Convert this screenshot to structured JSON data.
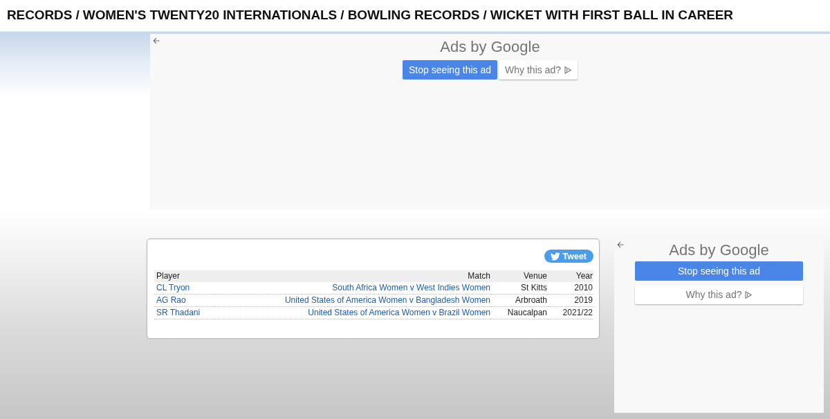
{
  "header": {
    "breadcrumb": "RECORDS / WOMEN'S TWENTY20 INTERNATIONALS / BOWLING RECORDS / WICKET WITH FIRST BALL IN CAREER"
  },
  "ads": [
    {
      "kind": "banner",
      "label": "Ads by Google",
      "buttons": [
        {
          "kind": "primary",
          "label": "Stop seeing this ad"
        },
        {
          "kind": "secondary",
          "label": "Why this ad?"
        }
      ]
    },
    {
      "kind": "sidebar",
      "label": "Ads by Google",
      "buttons": [
        {
          "kind": "primary",
          "label": "Stop seeing this ad"
        },
        {
          "kind": "secondary",
          "label": "Why this ad?"
        }
      ]
    }
  ],
  "records": {
    "tweet_button": "Tweet",
    "columns": [
      "Player",
      "Match",
      "Venue",
      "Year"
    ],
    "rows": [
      {
        "player": "CL Tryon",
        "match": "South Africa Women v West Indies Women",
        "venue": "St Kitts",
        "year": "2010"
      },
      {
        "player": "AG Rao",
        "match": "United States of America Women v Bangladesh Women",
        "venue": "Arbroath",
        "year": "2019"
      },
      {
        "player": "SR Thadani",
        "match": "United States of America Women v Brazil Women",
        "venue": "Naucalpan",
        "year": "2021/22"
      }
    ]
  }
}
